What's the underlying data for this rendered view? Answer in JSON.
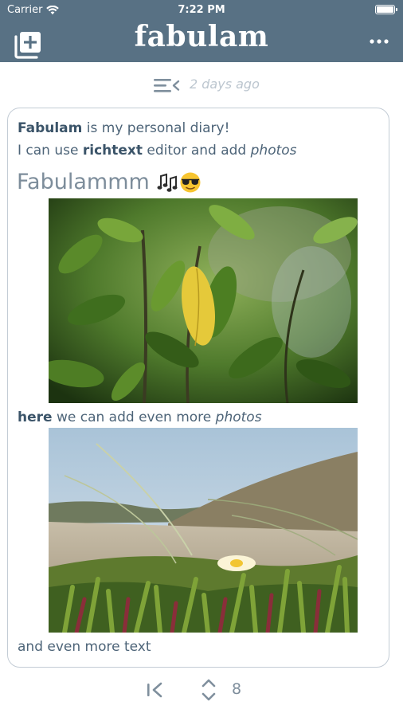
{
  "status_bar": {
    "carrier": "Carrier",
    "time": "7:22 PM"
  },
  "header": {
    "title": "fabulam",
    "new_entry_icon": "new-entry-icon",
    "more_icon": "more-icon",
    "background_color": "#587184"
  },
  "entry": {
    "date": "2 days ago",
    "line1": {
      "bold": "Fabulam",
      "rest": " is my personal diary!"
    },
    "line2": {
      "prefix": "I can use ",
      "bold": "richtext",
      "middle": " editor and add ",
      "italic": "photos"
    },
    "heading": {
      "text": "Fabulammm",
      "emoji": [
        "🎶",
        "😎"
      ]
    },
    "line3": {
      "bold": "here",
      "middle": " we can add even more ",
      "italic": "photos"
    },
    "line4": "and even more text"
  },
  "bottom_bar": {
    "count": "8"
  }
}
